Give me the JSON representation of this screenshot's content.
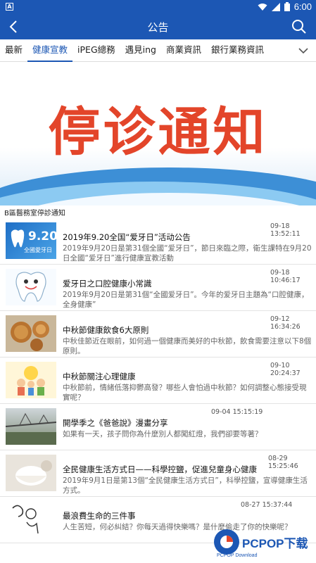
{
  "status_bar": {
    "time": "6:00",
    "app_badge": "A"
  },
  "app_bar": {
    "title": "公告"
  },
  "tabs": [
    {
      "label": "最新",
      "active": false
    },
    {
      "label": "健康宣教",
      "active": true
    },
    {
      "label": "iPEG總務",
      "active": false
    },
    {
      "label": "遇見ing",
      "active": false
    },
    {
      "label": "商業資訊",
      "active": false
    },
    {
      "label": "銀行業務資訊",
      "active": false
    }
  ],
  "banner": {
    "text": "停诊通知"
  },
  "section_label": "B區醫務室停診通知",
  "items": [
    {
      "date": "09-18 13:52:11",
      "title": "2019年9.20全国“爱牙日”活动公告",
      "desc": "2019年9月20日是第31個全國“爱牙日”，節日來臨之際，衛生課特在9月20日全國“爱牙日”進行健康宣教活動",
      "thumb": "teeth-920",
      "thumb_text": "9.20",
      "thumb_sub": "全國愛牙日"
    },
    {
      "date": "09-18 10:46:17",
      "title": "爱牙日之口腔健康小常識",
      "desc": "2019年9月20日是第31個“全國爱牙日”。今年的爱牙日主題為“口腔健康，全身健康”",
      "thumb": "tooth-cartoon"
    },
    {
      "date": "09-12 16:34:26",
      "title": "中秋節健康飲食6大原則",
      "desc": "中秋佳節近在眼前，如何過一個健康而美好的中秋節，飲食需要注意以下8個原則。",
      "thumb": "mooncakes"
    },
    {
      "date": "09-10 20:24:37",
      "title": "中秋節關注心理健康",
      "desc": "中秋節前，情緒低落抑鬱高發？哪些人會怕過中秋節？如何調整心態接受現實呢？",
      "thumb": "family-illustration"
    },
    {
      "date": "09-04 15:15:19",
      "title": "開學季之《爸爸說》漫畫分享",
      "desc": "如果有一天，孩子問你為什麼別人都闖紅燈，我們卻要等著？",
      "thumb": "bridge-river"
    },
    {
      "date": "08-29 15:25:46",
      "title": "全民健康生活方式日——科學控鹽，促進兒童身心健康",
      "desc": "2019年9月1日是第13個“全民健康生活方式日”，科學控鹽，宣導健康生活方式。",
      "thumb": "salt-shaker"
    },
    {
      "date": "08-27 15:37:44",
      "title": "最浪費生命的三件事",
      "desc": "人生苦短，何必糾結？你每天過得快樂嗎？是什麼偷走了你的快樂呢？",
      "thumb": "ink-sketch"
    }
  ],
  "watermark": {
    "text": "PCPOP下载",
    "sub": "PCPOP Download"
  },
  "colors": {
    "primary": "#1c57b4",
    "banner_text": "#e3452a"
  }
}
